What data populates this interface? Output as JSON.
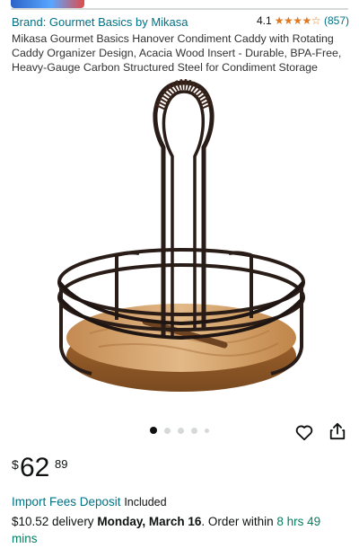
{
  "brand": {
    "label": "Brand: Gourmet Basics by Mikasa",
    "rating_value": "4.1",
    "stars_display": "★★★★☆",
    "rating_count": "(857)"
  },
  "product": {
    "title": "Mikasa Gourmet Basics Hanover Condiment Caddy with Rotating Caddy Organizer Design, Acacia Wood Insert - Durable, BPA-Free, Heavy-Gauge Carbon Structured Steel for Condiment Storage",
    "image_icon": "condiment-caddy-image"
  },
  "carousel": {
    "total_images": 5,
    "active_index": 0
  },
  "actions": {
    "wishlist_icon": "heart-icon",
    "share_icon": "share-icon"
  },
  "price": {
    "symbol": "$",
    "whole": "62",
    "fraction": "89"
  },
  "import": {
    "link_text": "Import Fees Deposit",
    "status": "Included"
  },
  "delivery": {
    "price_text": "$10.52 delivery",
    "date": "Monday, March 16",
    "order_prefix": ". Order within",
    "countdown": "8 hrs 49 mins"
  },
  "colors": {
    "link": "#007185",
    "star": "#de7921",
    "countdown": "#067d62",
    "text": "#0f1111"
  }
}
